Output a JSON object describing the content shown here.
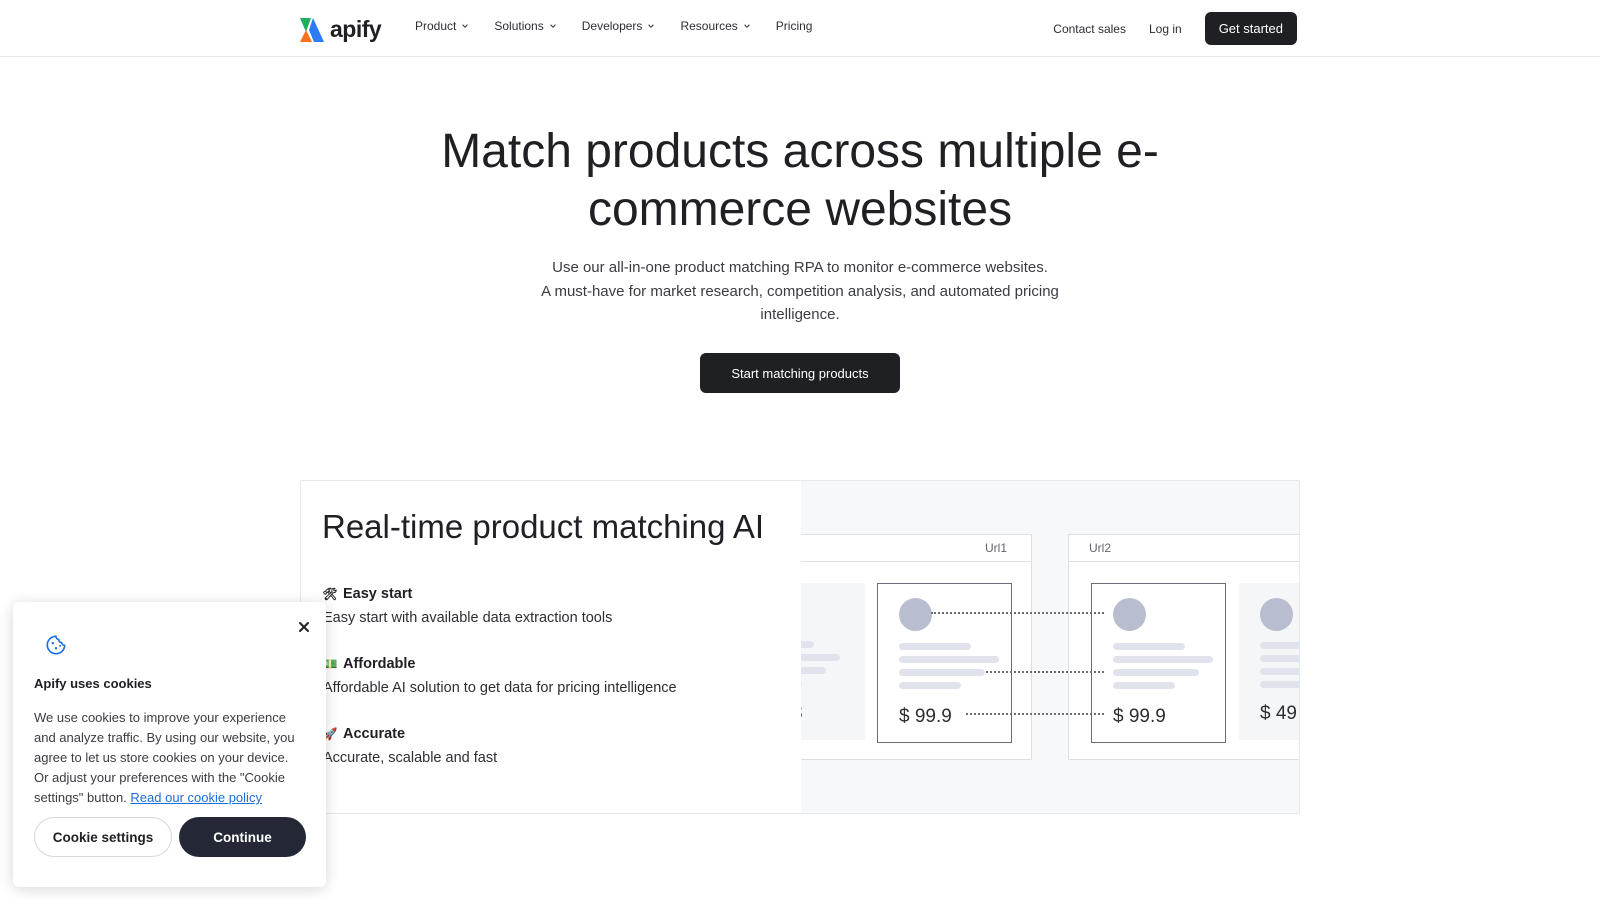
{
  "nav": {
    "logo_text": "apify",
    "menu": [
      {
        "label": "Product",
        "has_dropdown": true
      },
      {
        "label": "Solutions",
        "has_dropdown": true
      },
      {
        "label": "Developers",
        "has_dropdown": true
      },
      {
        "label": "Resources",
        "has_dropdown": true
      },
      {
        "label": "Pricing",
        "has_dropdown": false
      }
    ],
    "contact_sales": "Contact sales",
    "log_in": "Log in",
    "get_started": "Get started"
  },
  "hero": {
    "title_line1": "Match products across multiple e-",
    "title_line2": "commerce websites",
    "subtitle_line1": "Use our all-in-one product matching RPA to monitor e-commerce websites.",
    "subtitle_line2": "A must-have for market research, competition analysis, and automated pricing",
    "subtitle_line3": "intelligence.",
    "cta": "Start matching products"
  },
  "feature": {
    "title": "Real-time product matching AI",
    "items": [
      {
        "icon": "tools-icon",
        "title": "Easy start",
        "desc": "Easy start with available data extraction tools"
      },
      {
        "icon": "money-icon",
        "title": "Affordable",
        "desc": "Affordable AI solution to get data for pricing intelligence"
      },
      {
        "icon": "rocket-icon",
        "title": "Accurate",
        "desc": "Accurate, scalable and fast"
      }
    ],
    "illustration": {
      "url1": "Url1",
      "url2": "Url2",
      "price_left_partial": "8",
      "price_1": "$ 99.9",
      "price_2": "$ 99.9",
      "price_right_partial": "$ 49"
    }
  },
  "cookie": {
    "title": "Apify uses cookies",
    "text": "We use cookies to improve your experience and analyze traffic. By using our website, you agree to let us store cookies on your device. Or adjust your preferences with the \"Cookie settings\" button.",
    "link": "Read our cookie policy",
    "settings_button": "Cookie settings",
    "continue_button": "Continue"
  },
  "colors": {
    "dark": "#1f2023",
    "accent_blue": "#1a6fe0",
    "logo_green": "#1fae5e",
    "logo_orange": "#f8711c",
    "logo_blue": "#2c7cf6"
  }
}
